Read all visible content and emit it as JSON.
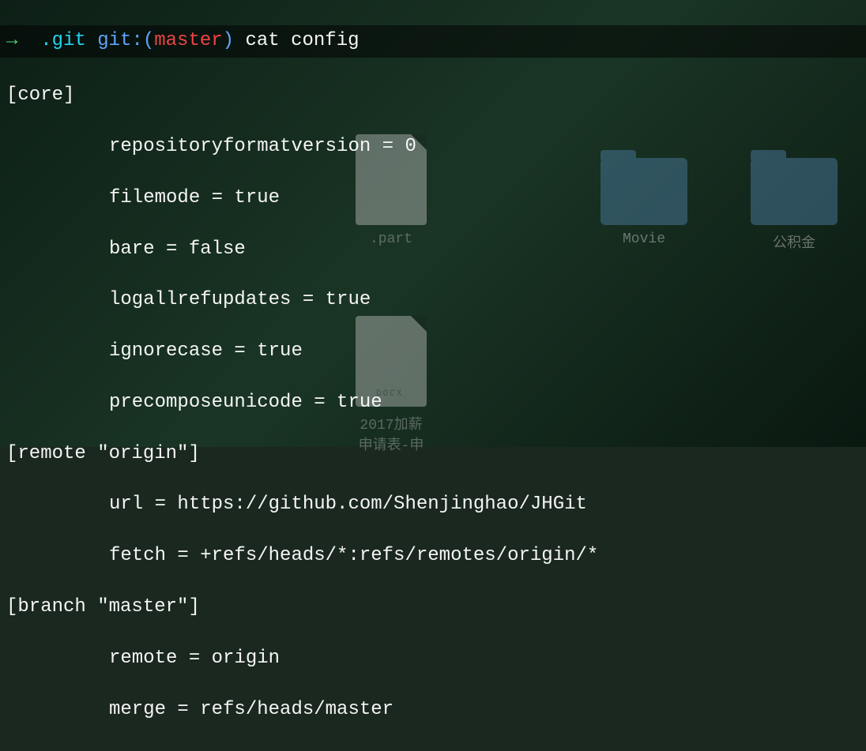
{
  "prompt": {
    "arrow": "→",
    "cwd": ".git",
    "git_prefix": "git:(",
    "branch": "master",
    "git_suffix": ")",
    "command": "cat config"
  },
  "output": {
    "sections": [
      {
        "header": "[core]",
        "entries": [
          "repositoryformatversion = 0",
          "filemode = true",
          "bare = false",
          "logallrefupdates = true",
          "ignorecase = true",
          "precomposeunicode = true"
        ]
      },
      {
        "header": "[remote \"origin\"]",
        "entries": [
          "url = https://github.com/Shenjinghao/JHGit",
          "fetch = +refs/heads/*:refs/remotes/origin/*"
        ]
      },
      {
        "header": "[branch \"master\"]",
        "entries": [
          "remote = origin",
          "merge = refs/heads/master"
        ]
      }
    ]
  },
  "desktop": {
    "part_file": ".part",
    "docx_tag": "DOCX",
    "docx_label": "2017加薪申请表-申",
    "folder_movie": "Movie",
    "folder_gjj": "公积金"
  }
}
